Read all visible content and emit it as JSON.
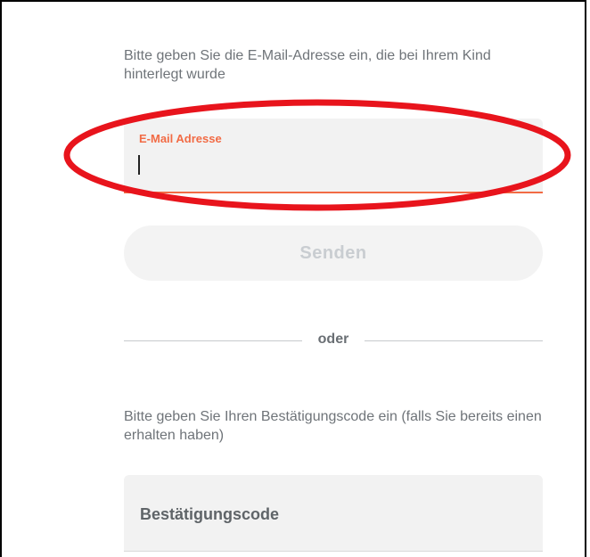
{
  "email_section": {
    "instruction": "Bitte geben Sie die E-Mail-Adresse ein, die bei Ihrem Kind hinterlegt wurde",
    "field_label": "E-Mail Adresse",
    "field_value": "",
    "accent_color": "#f26b45"
  },
  "send_button": {
    "label": "Senden",
    "state": "disabled"
  },
  "divider": {
    "label": "oder"
  },
  "code_section": {
    "instruction": "Bitte geben Sie Ihren Bestätigungscode ein (falls Sie bereits einen erhalten haben)",
    "field_placeholder": "Bestätigungscode"
  },
  "annotation": {
    "color": "#e8141c"
  }
}
